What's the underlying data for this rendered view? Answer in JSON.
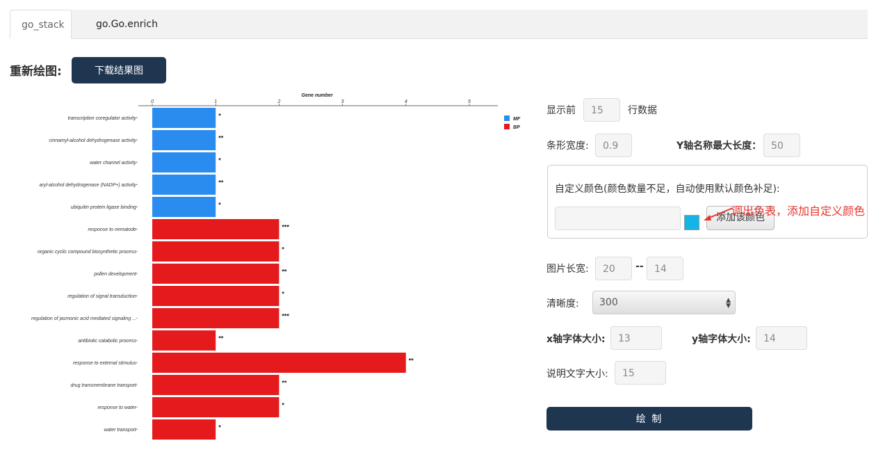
{
  "tabs": [
    "go_stack",
    "go.Go.enrich"
  ],
  "redraw_label": "重新绘图:",
  "download_button": "下载结果图",
  "form": {
    "show_top_label": "显示前",
    "show_top_value": "15",
    "show_top_suffix": "行数据",
    "bar_width_label": "条形宽度:",
    "bar_width_value": "0.9",
    "y_name_len_label": "Y轴名称最大长度：",
    "y_name_len_value": "50",
    "custom_color_label": "自定义颜色(颜色数量不足，自动使用默认颜色补足):",
    "custom_color_input": "",
    "custom_color_swatch": "#14b4e6",
    "add_color_button": "添加该颜色",
    "annotation": "调出色表，添加自定义颜色",
    "size_label": "图片长宽:",
    "width_value": "20",
    "size_sep": "--",
    "height_value": "14",
    "dpi_label": "清晰度:",
    "dpi_value": "300",
    "x_font_label": "x轴字体大小:",
    "x_font_value": "13",
    "y_font_label": "y轴字体大小:",
    "y_font_value": "14",
    "caption_font_label": "说明文字大小:",
    "caption_font_value": "15",
    "draw_button": "绘 制"
  },
  "colors": {
    "MF": "#2b8cf0",
    "BP": "#e41a1c",
    "accent": "#1f3651",
    "annotation": "#e8342c"
  },
  "chart_data": {
    "type": "bar",
    "orientation": "horizontal",
    "xlabel": "Gene number",
    "x_axis_position": "top",
    "xlim": [
      0,
      5
    ],
    "xticks": [
      0,
      1,
      2,
      3,
      4,
      5
    ],
    "legend_position": "top-right",
    "legend": [
      "MF",
      "BP"
    ],
    "categories": [
      "transcription coregulator activity",
      "cinnamyl-alcohol dehydrogenase activity",
      "water channel activity",
      "aryl-alcohol dehydrogenase (NADP+) activity",
      "ubiquitin protein ligase binding",
      "response to nematode",
      "organic cyclic compound biosynthetic process",
      "pollen development",
      "regulation of signal transduction",
      "regulation of jasmonic acid mediated signaling ...",
      "antibiotic catabolic process",
      "response to external stimulus",
      "drug transmembrane transport",
      "response to water",
      "water transport"
    ],
    "values": [
      1,
      1,
      1,
      1,
      1,
      2,
      2,
      2,
      2,
      2,
      1,
      4,
      2,
      2,
      1
    ],
    "groups": [
      "MF",
      "MF",
      "MF",
      "MF",
      "MF",
      "BP",
      "BP",
      "BP",
      "BP",
      "BP",
      "BP",
      "BP",
      "BP",
      "BP",
      "BP"
    ],
    "significance": [
      "*",
      "**",
      "*",
      "**",
      "*",
      "***",
      "*",
      "**",
      "*",
      "***",
      "**",
      "**",
      "**",
      "*",
      "*"
    ]
  }
}
